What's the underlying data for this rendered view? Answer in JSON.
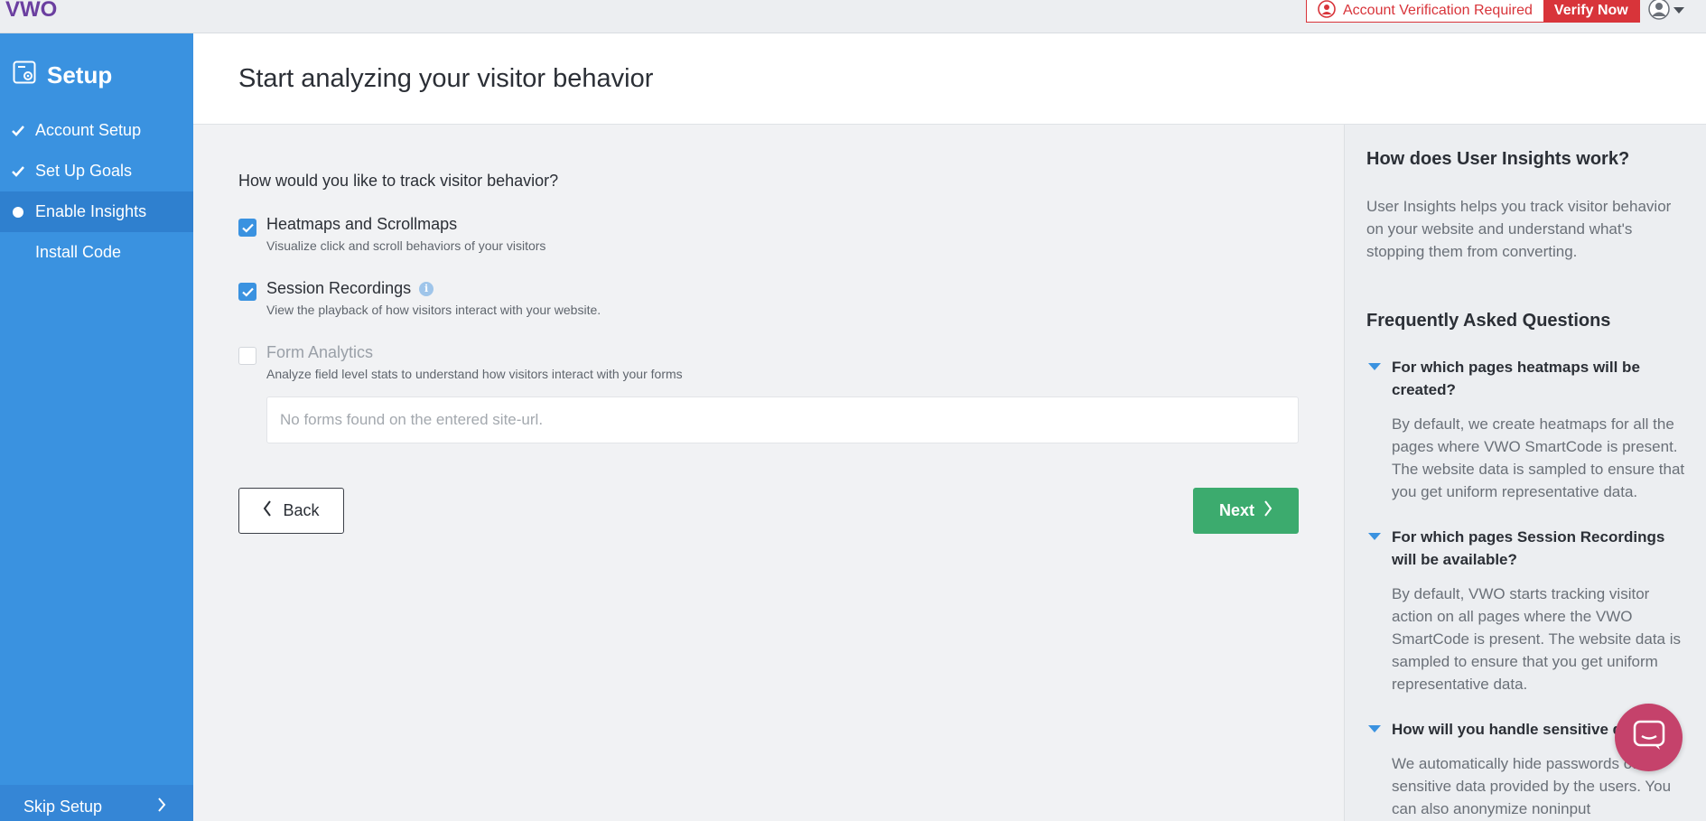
{
  "topbar": {
    "logo_text": "VWO",
    "verification_message": "Account Verification Required",
    "verify_button": "Verify Now"
  },
  "sidebar": {
    "title": "Setup",
    "items": [
      {
        "label": "Account Setup",
        "state": "done"
      },
      {
        "label": "Set Up Goals",
        "state": "done"
      },
      {
        "label": "Enable Insights",
        "state": "active"
      },
      {
        "label": "Install Code",
        "state": "pending"
      }
    ],
    "skip_label": "Skip Setup"
  },
  "header": {
    "title": "Start analyzing your visitor behavior"
  },
  "main": {
    "question": "How would you like to track visitor behavior?",
    "options": [
      {
        "label": "Heatmaps and Scrollmaps",
        "description": "Visualize click and scroll behaviors of your visitors",
        "checked": true,
        "disabled": false
      },
      {
        "label": "Session Recordings",
        "description": "View the playback of how visitors interact with your website.",
        "checked": true,
        "disabled": false
      },
      {
        "label": "Form Analytics",
        "description": "Analyze field level stats to understand how visitors interact with your forms",
        "checked": false,
        "disabled": true
      }
    ],
    "forms_placeholder": "No forms found on the entered site-url.",
    "back_button": "Back",
    "next_button": "Next"
  },
  "panel": {
    "heading": "How does User Insights work?",
    "intro": "User Insights helps you track visitor behavior on your website and understand what's stopping them from converting.",
    "faq_heading": "Frequently Asked Questions",
    "faqs": [
      {
        "q": "For which pages heatmaps will be created?",
        "a": "By default, we create heatmaps for all the pages where VWO SmartCode is present. The website data is sampled to ensure that you get uniform representative data."
      },
      {
        "q": "For which pages Session Recordings will be available?",
        "a": "By default, VWO starts tracking visitor action on all pages where the VWO SmartCode is present. The website data is sampled to ensure that you get uniform representative data."
      },
      {
        "q": "How will you handle sensitive d",
        "a": "We automatically hide passwords other sensitive data provided by the users. You can also anonymize noninput"
      }
    ]
  },
  "colors": {
    "sidebar": "#3a92e0",
    "primary_green": "#3cab6e",
    "alert_red": "#d8343a",
    "chat": "#c5426b"
  },
  "icons": [
    "vwo-logo",
    "user-alert-icon",
    "avatar-icon",
    "setup-icon",
    "check-icon",
    "info-icon",
    "chevron-left-icon",
    "chevron-right-icon",
    "caret-down-icon",
    "chat-icon"
  ]
}
